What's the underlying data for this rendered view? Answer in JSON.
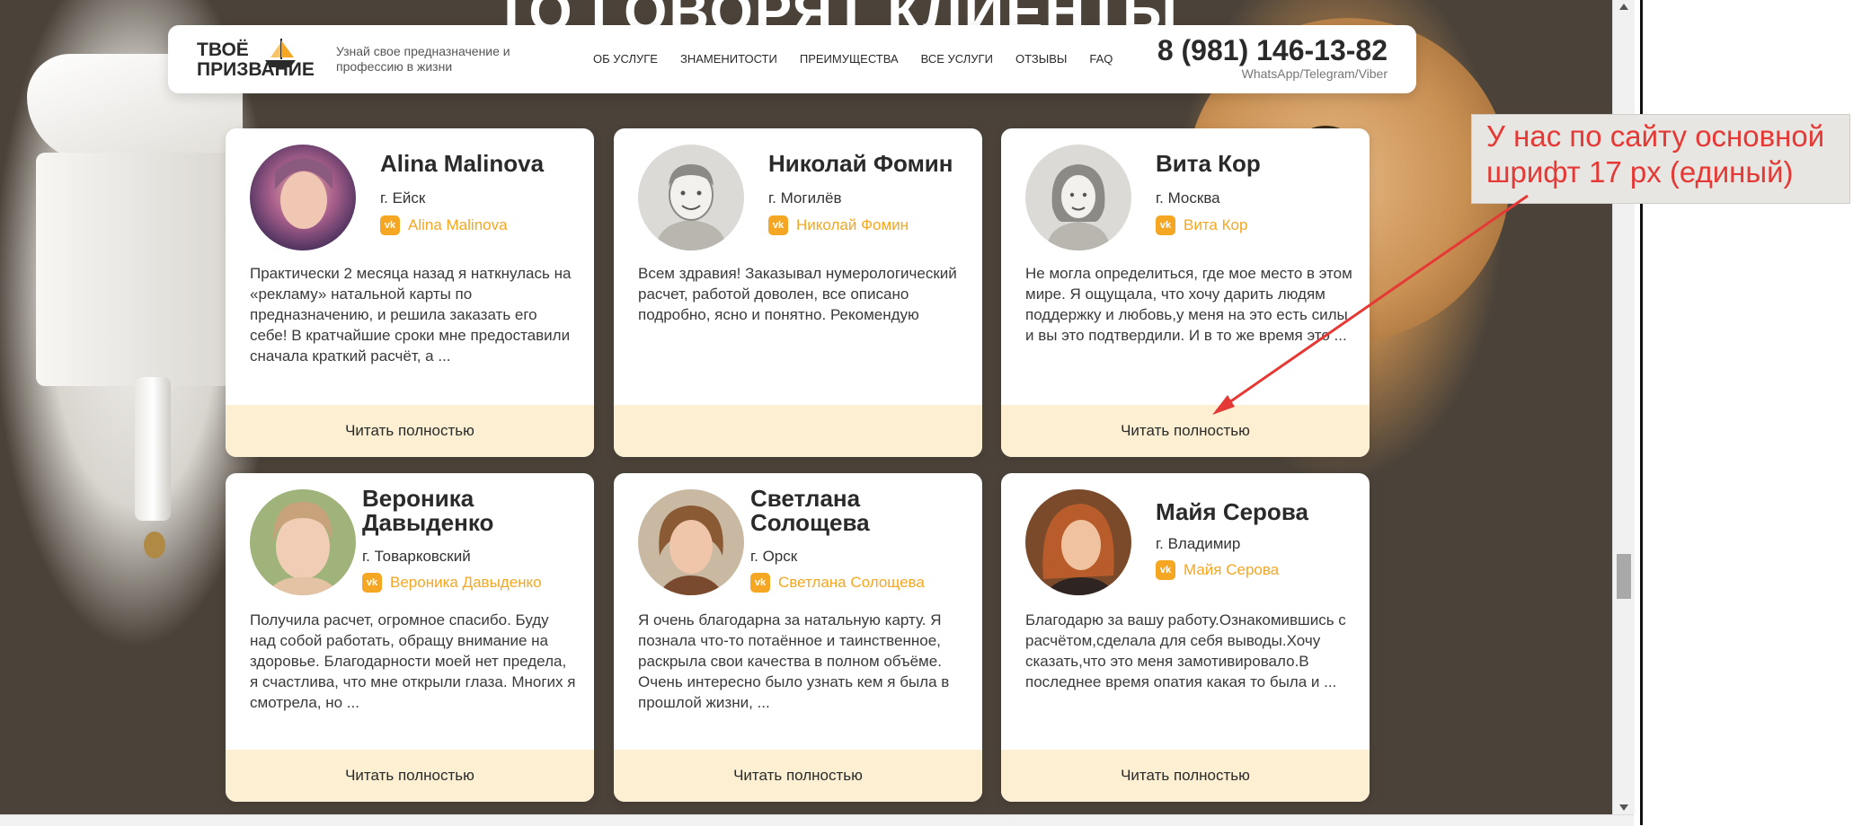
{
  "page": {
    "big_heading": "ТО ГОВОРЯТ КЛИЕНТЫ"
  },
  "header": {
    "logo_line1": "ТВОЁ",
    "logo_line2": "ПРИЗВАНИЕ",
    "tagline": "Узнай свое предназначение и профессию в жизни",
    "nav": [
      "ОБ УСЛУГЕ",
      "ЗНАМЕНИТОСТИ",
      "ПРЕИМУЩЕСТВА",
      "ВСЕ УСЛУГИ",
      "ОТЗЫВЫ",
      "FAQ"
    ],
    "phone": "8 (981) 146-13-82",
    "phone_sub": "WhatsApp/Telegram/Viber"
  },
  "reviews": [
    {
      "name": "Alina Malinova",
      "city": "г. Ейск",
      "vk": "Alina Malinova",
      "text": "Практически 2 месяца назад я наткнулась на «рекламу» натальной карты по предназначению, и решила заказать его себе! В кратчайшие сроки мне предоставили сначала краткий расчёт, а ...",
      "read_more": "Читать полностью"
    },
    {
      "name": "Николай Фомин",
      "city": "г. Могилёв",
      "vk": "Николай Фомин",
      "text": "Всем здравия! Заказывал нумерологический расчет, работой доволен, все описано подробно, ясно и понятно. Рекомендую",
      "read_more": ""
    },
    {
      "name": "Вита Кор",
      "city": "г. Москва",
      "vk": "Вита Кор",
      "text": "Не могла определиться, где мое место в этом мире. Я ощущала, что хочу дарить людям поддержку и любовь,у меня на это есть силы и вы это подтвердили. И в то же время это ...",
      "read_more": "Читать полностью"
    },
    {
      "name": "Вероника Давыденко",
      "city": "г. Товарковский",
      "vk": "Вероника Давыденко",
      "text": "Получила расчет, огромное спасибо. Буду над собой работать, обращу внимание на здоровье. Благодарности моей нет предела, я счастлива, что мне открыли глаза. Многих я смотрела, но ...",
      "read_more": "Читать полностью"
    },
    {
      "name": "Светлана Солощева",
      "city": "г. Орск",
      "vk": "Светлана Солощева",
      "text": "Я очень благодарна за натальную карту. Я познала что-то потаённое и таинственное, раскрыла свои качества в полном объёме. Очень интересно было узнать кем я была в прошлой жизни, ...",
      "read_more": "Читать полностью"
    },
    {
      "name": "Майя Серова",
      "city": "г. Владимир",
      "vk": "Майя Серова",
      "text": "Благодарю за вашу работу.Ознакомившись с расчётом,сделала для себя выводы.Хочу сказать,что это меня замотивировало.В последнее время опатия какая то была и ...",
      "read_more": "Читать полностью"
    }
  ],
  "annotation": {
    "line1": "У нас по сайту основной",
    "line2": "шрифт 17 px (единый)"
  },
  "colors": {
    "accent": "#f5a623",
    "button_bg": "#fdefd2",
    "annotation": "#e53935"
  }
}
